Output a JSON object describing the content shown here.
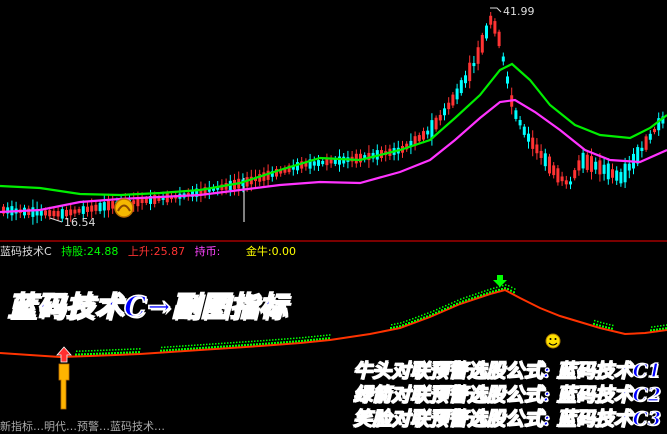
{
  "price_high_label": "41.99",
  "price_low_label": "16.54",
  "indicator_bar": {
    "name": "蓝码技术C",
    "hold_label": "持股:",
    "hold_value": "24.88",
    "rise_label": "上升:",
    "rise_value": "25.87",
    "cash_label": "持币:",
    "gold_label": "金牛:",
    "gold_value": "0.00"
  },
  "banner_title": "蓝码技术C→副图指标",
  "formulas": [
    "牛头对联预警选股公式: 蓝码技术C1",
    "绿箭对联预警选股公式: 蓝码技术C2",
    "笑脸对联预警选股公式: 蓝码技术C3"
  ],
  "bottom_text": "新指标…明代…预警…蓝码技术…",
  "colors": {
    "up_candle": "#ff3333",
    "down_candle": "#00ffff",
    "green_line": "#00ee00",
    "magenta_line": "#ff33ff",
    "indicator_line": "#ff3300",
    "dot_green": "#00ff00"
  },
  "icons": [
    "gold-coin-icon",
    "smiley-icon",
    "red-up-arrow-icon",
    "green-down-arrow-icon"
  ]
}
